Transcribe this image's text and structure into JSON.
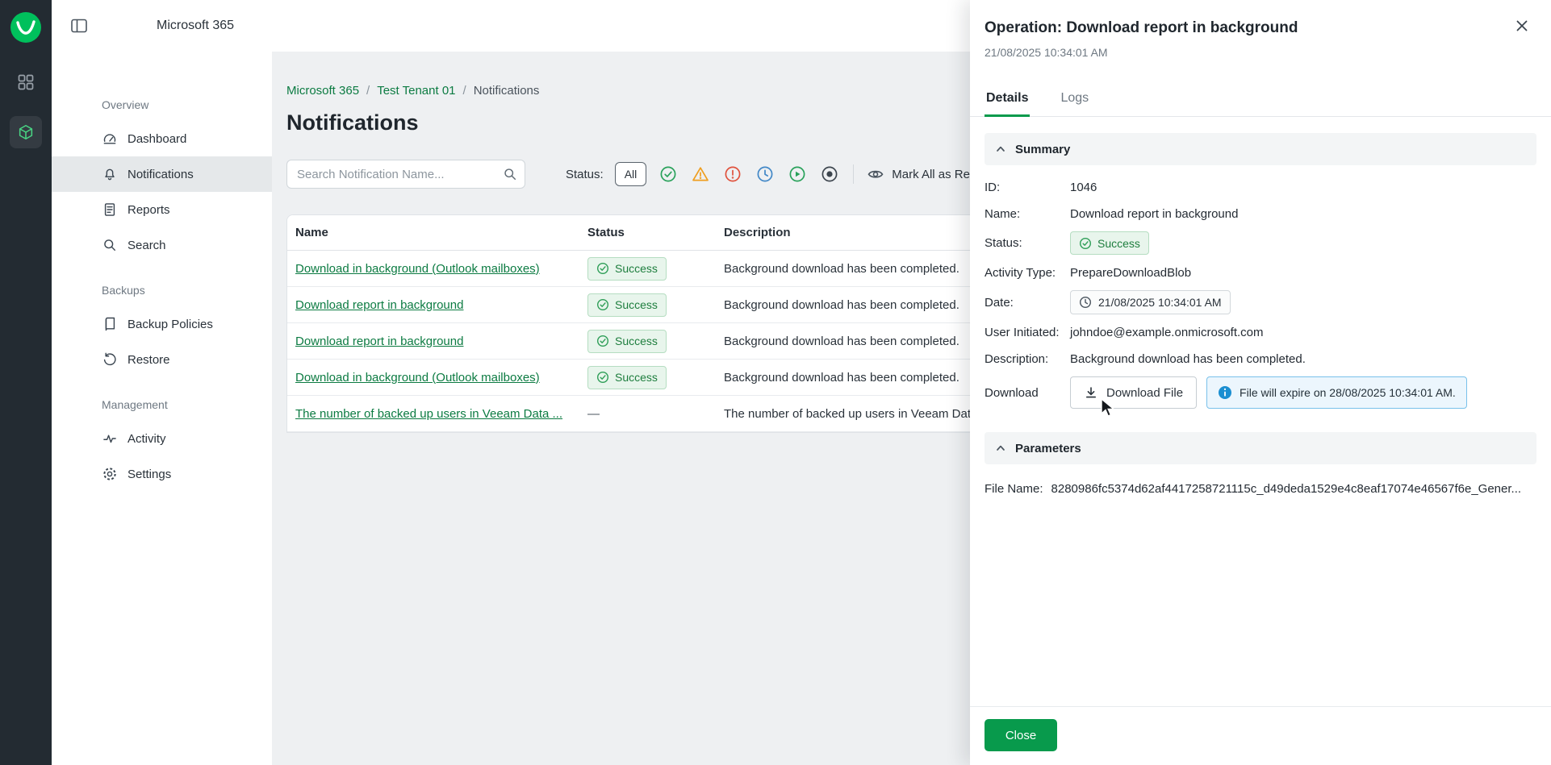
{
  "colors": {
    "accent_green": "#089a4c",
    "link_green": "#0c7b42",
    "success_text": "#1e7e3e",
    "success_bg": "#e8f5ec",
    "info_border": "#79c1ea",
    "info_icon": "#1b8fd1",
    "rail_bg": "#232b32"
  },
  "topbar": {
    "product": "Microsoft 365"
  },
  "sidebar": {
    "sections": [
      {
        "label": "Overview",
        "items": [
          {
            "label": "Dashboard"
          },
          {
            "label": "Notifications"
          },
          {
            "label": "Reports"
          },
          {
            "label": "Search"
          }
        ]
      },
      {
        "label": "Backups",
        "items": [
          {
            "label": "Backup Policies"
          },
          {
            "label": "Restore"
          }
        ]
      },
      {
        "label": "Management",
        "items": [
          {
            "label": "Activity"
          },
          {
            "label": "Settings"
          }
        ]
      }
    ]
  },
  "breadcrumb": {
    "crumb1": "Microsoft 365",
    "sep": "/",
    "crumb2": "Test Tenant 01",
    "crumb3": "Notifications"
  },
  "page": {
    "title": "Notifications"
  },
  "toolbar": {
    "search_placeholder": "Search Notification Name...",
    "status_label": "Status:",
    "all_label": "All",
    "mark_all_read": "Mark All as Read",
    "filter_icons": [
      "success-icon",
      "warning-icon",
      "error-icon",
      "pending-icon",
      "running-icon",
      "stopped-icon"
    ]
  },
  "table": {
    "headers": {
      "name": "Name",
      "status": "Status",
      "description": "Description"
    },
    "rows": [
      {
        "name": "Download in background (Outlook mailboxes)",
        "status": "Success",
        "description": "Background download has been completed."
      },
      {
        "name": "Download report in background",
        "status": "Success",
        "description": "Background download has been completed."
      },
      {
        "name": "Download report in background",
        "status": "Success",
        "description": "Background download has been completed."
      },
      {
        "name": "Download in background (Outlook mailboxes)",
        "status": "Success",
        "description": "Background download has been completed."
      },
      {
        "name": "The number of backed up users in Veeam Data ...",
        "status": "—",
        "description": "The number of backed up users in Veeam Data..."
      }
    ]
  },
  "panel": {
    "title": "Operation: Download report in background",
    "timestamp": "21/08/2025 10:34:01 AM",
    "tabs": {
      "details": "Details",
      "logs": "Logs"
    },
    "summary": {
      "heading": "Summary",
      "id_label": "ID:",
      "id_value": "1046",
      "name_label": "Name:",
      "name_value": "Download report in background",
      "status_label": "Status:",
      "status_value": "Success",
      "activity_label": "Activity Type:",
      "activity_value": "PrepareDownloadBlob",
      "date_label": "Date:",
      "date_value": "21/08/2025 10:34:01 AM",
      "user_label": "User Initiated:",
      "user_value": "johndoe@example.onmicrosoft.com",
      "description_label": "Description:",
      "description_value": "Background download has been completed.",
      "download_label": "Download",
      "download_button": "Download File",
      "expire_note": "File will expire on 28/08/2025 10:34:01 AM."
    },
    "parameters": {
      "heading": "Parameters",
      "file_name_label": "File Name:",
      "file_name_value": "8280986fc5374d62af4417258721115c_d49deda1529e4c8eaf17074e46567f6e_Gener..."
    },
    "close_button": "Close"
  }
}
